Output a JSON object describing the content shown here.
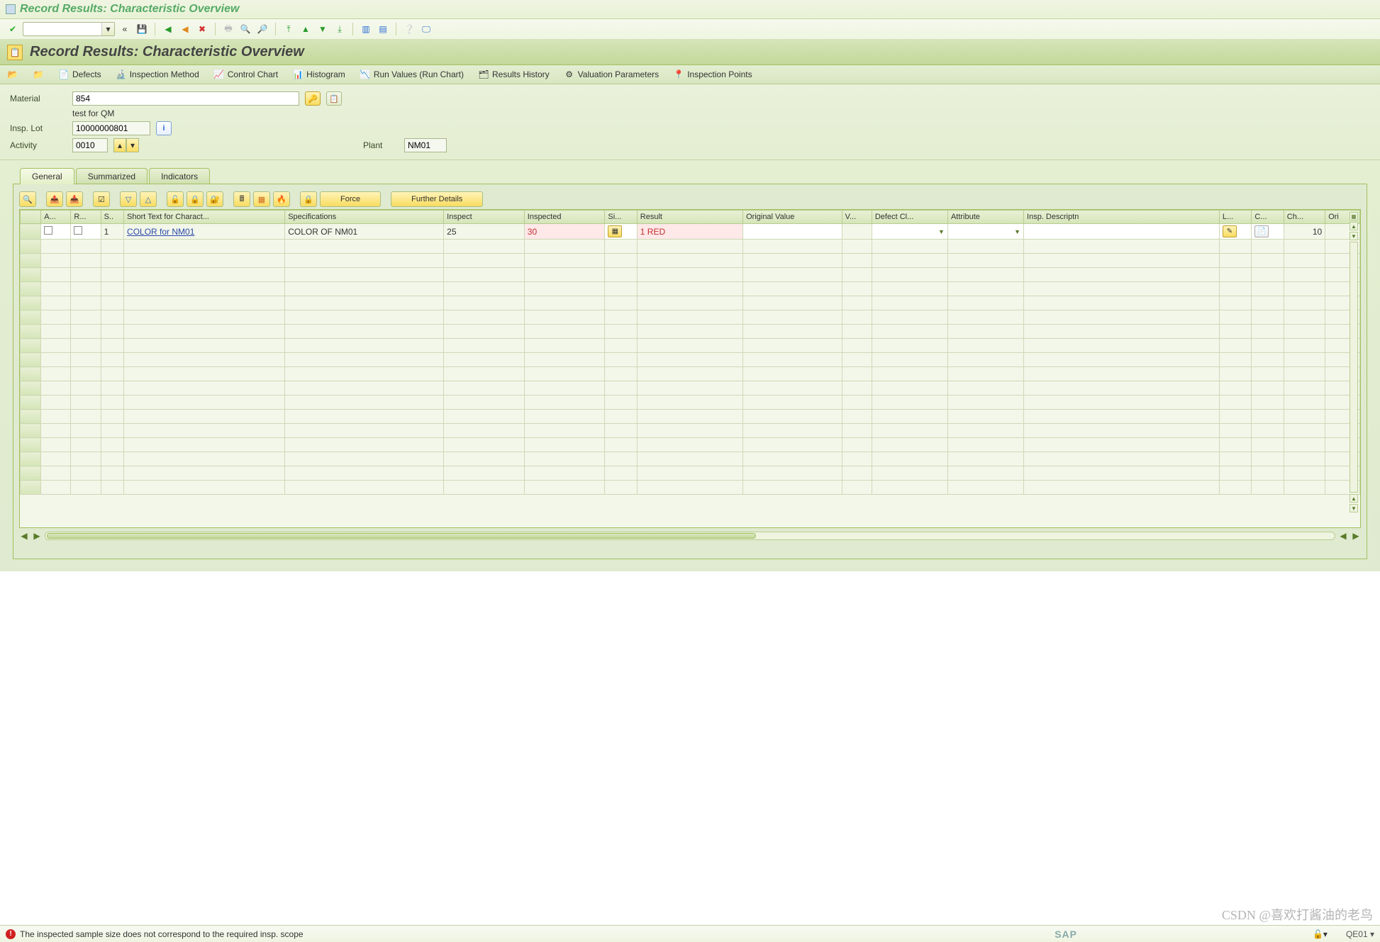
{
  "window": {
    "title": "Record Results: Characteristic Overview"
  },
  "app": {
    "title": "Record Results: Characteristic Overview"
  },
  "sysToolbar": {
    "okIcon": "✔",
    "backIcon": "«",
    "saveIcon": "💾"
  },
  "appToolbar": {
    "defects": "Defects",
    "inspMethod": "Inspection Method",
    "controlChart": "Control Chart",
    "histogram": "Histogram",
    "runValues": "Run Values (Run Chart)",
    "resultsHistory": "Results History",
    "valuationParams": "Valuation Parameters",
    "inspPoints": "Inspection Points"
  },
  "form": {
    "materialLabel": "Material",
    "materialValue": "854",
    "materialDesc": "test for QM",
    "inspLotLabel": "Insp. Lot",
    "inspLotValue": "10000000801",
    "activityLabel": "Activity",
    "activityValue": "0010",
    "plantLabel": "Plant",
    "plantValue": "NM01"
  },
  "tabs": {
    "general": "General",
    "summarized": "Summarized",
    "indicators": "Indicators"
  },
  "gridToolbar": {
    "force": "Force",
    "furtherDetails": "Further Details"
  },
  "columns": {
    "a": "A...",
    "r": "R...",
    "s": "S..",
    "shortText": "Short Text for Charact...",
    "specs": "Specifications",
    "inspect": "Inspect",
    "inspected": "Inspected",
    "si": "Si...",
    "result": "Result",
    "origValue": "Original Value",
    "v": "V...",
    "defectCl": "Defect Cl...",
    "attribute": "Attribute",
    "inspDesc": "Insp. Descriptn",
    "l": "L...",
    "c": "C...",
    "ch": "Ch...",
    "ori": "Ori"
  },
  "row1": {
    "s": "1",
    "shortText": "COLOR for NM01",
    "specs": "COLOR OF NM01",
    "inspect": "25",
    "inspected": "30",
    "result": "1 RED",
    "ch": "10"
  },
  "status": {
    "message": "The inspected sample size does not correspond to the required insp. scope",
    "sap": "SAP",
    "tcode": "QE01"
  },
  "watermark": "CSDN @喜欢打酱油的老鸟"
}
